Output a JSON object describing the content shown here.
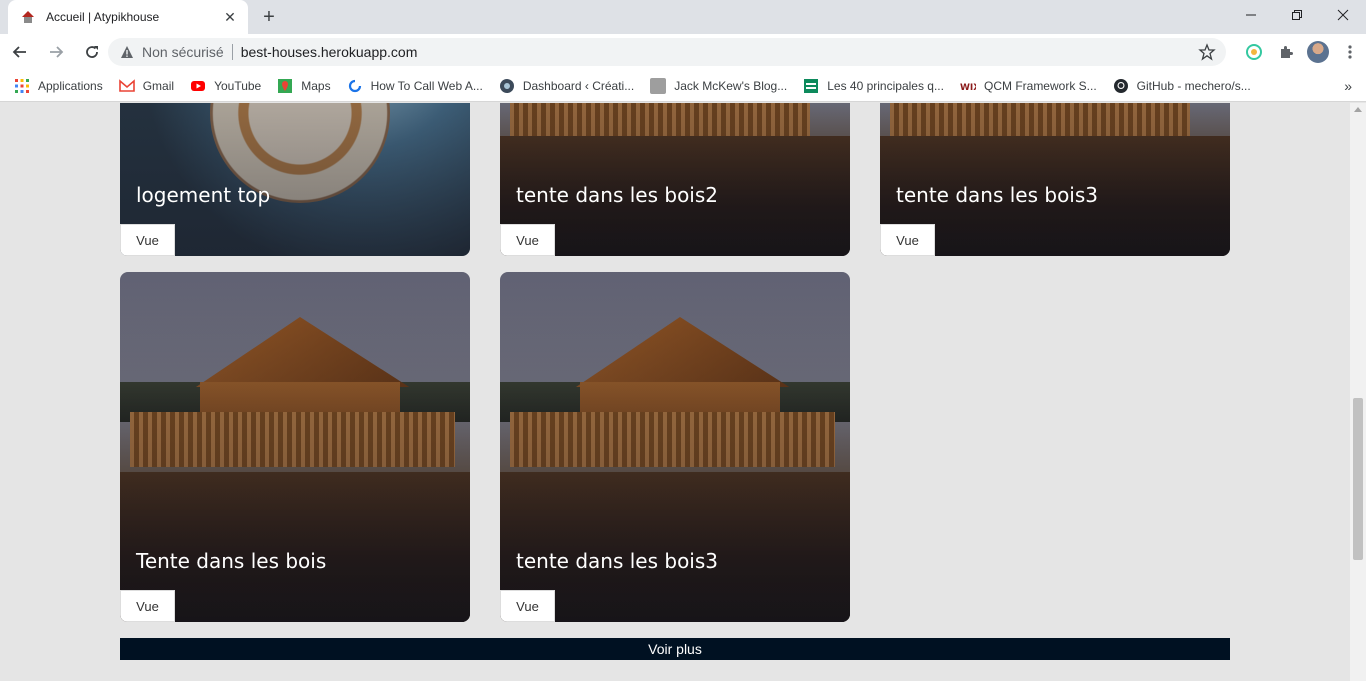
{
  "browser": {
    "tab_title": "Accueil | Atypikhouse",
    "security_status": "Non sécurisé",
    "url": "best-houses.herokuapp.com"
  },
  "bookmarks": [
    {
      "label": "Applications",
      "icon": "apps-grid-icon",
      "color": "#ea4335"
    },
    {
      "label": "Gmail",
      "icon": "gmail-icon",
      "color": "#ea4335"
    },
    {
      "label": "YouTube",
      "icon": "youtube-icon",
      "color": "#ff0000"
    },
    {
      "label": "Maps",
      "icon": "maps-icon",
      "color": "#34a853"
    },
    {
      "label": "How To Call Web A...",
      "icon": "refresh-circle-icon",
      "color": "#1a73e8"
    },
    {
      "label": "Dashboard ‹ Créati...",
      "icon": "dashboard-icon",
      "color": "#3c4a5a"
    },
    {
      "label": "Jack McKew's Blog...",
      "icon": "page-icon",
      "color": "#9e9e9e"
    },
    {
      "label": "Les 40 principales q...",
      "icon": "green-page-icon",
      "color": "#0d8a5c"
    },
    {
      "label": "QCM Framework S...",
      "icon": "wix-icon",
      "color": "#8b1a1a"
    },
    {
      "label": "GitHub - mechero/s...",
      "icon": "github-icon",
      "color": "#24292e"
    }
  ],
  "cards_row1": [
    {
      "title": "logement top",
      "button": "Vue",
      "image": "pocket-watch"
    },
    {
      "title": "tente dans les bois2",
      "button": "Vue",
      "image": "wooden-cabin-on-water"
    },
    {
      "title": "tente dans les bois3",
      "button": "Vue",
      "image": "wooden-cabin-on-water"
    }
  ],
  "cards_row2": [
    {
      "title": "Tente dans les bois",
      "button": "Vue",
      "image": "wooden-cabin-on-water"
    },
    {
      "title": "tente dans les bois3",
      "button": "Vue",
      "image": "wooden-cabin-on-water"
    }
  ],
  "voir_plus": "Voir plus",
  "colors": {
    "page_bg": "#e5e5e5",
    "voir_plus_bg": "#001122",
    "card_button_bg": "#ffffff"
  }
}
